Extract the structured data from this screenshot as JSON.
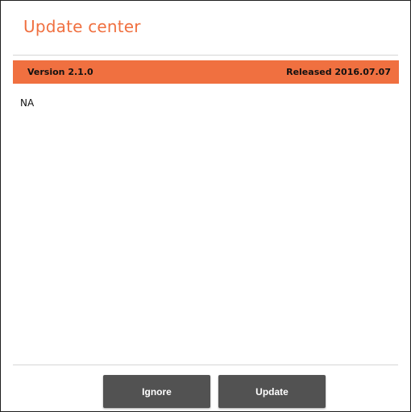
{
  "dialog": {
    "title": "Update center"
  },
  "release": {
    "version_label": "Version 2.1.0",
    "released_label": "Released 2016.07.07",
    "notes": "NA"
  },
  "actions": {
    "ignore_label": "Ignore",
    "update_label": "Update"
  },
  "colors": {
    "accent": "#f07040",
    "button_bg": "#525252",
    "button_text": "#ffffff",
    "divider": "#d6d6d6"
  }
}
